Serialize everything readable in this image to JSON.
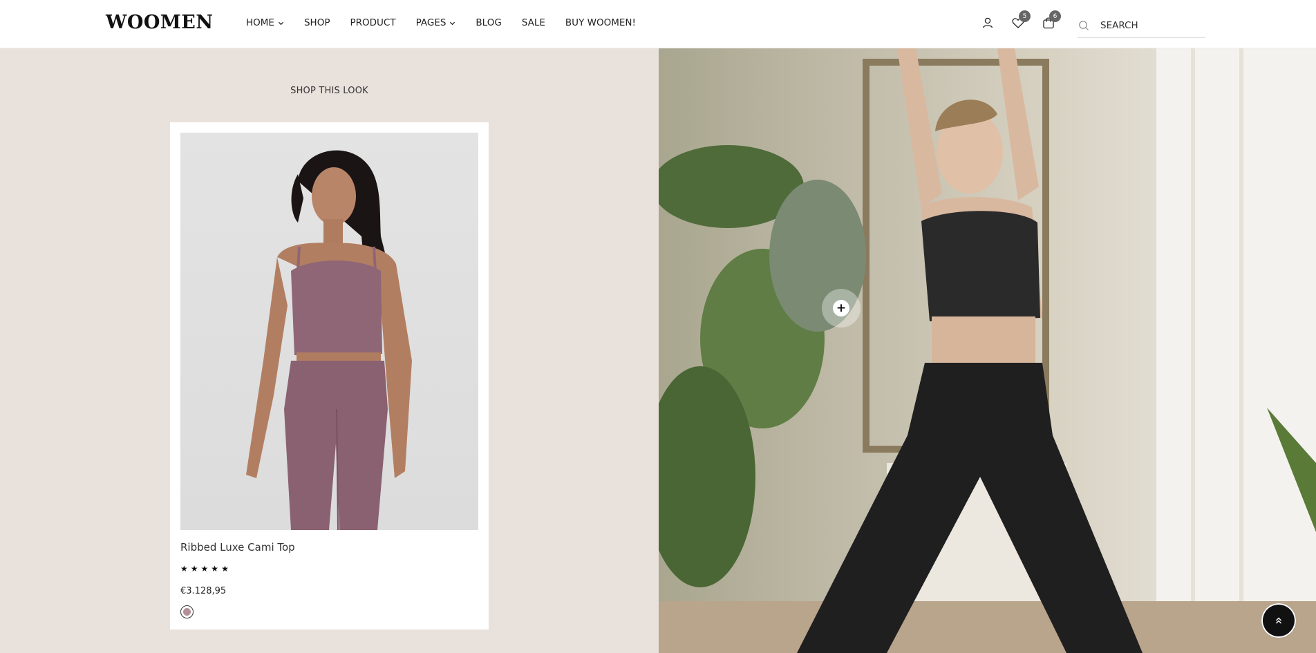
{
  "brand": {
    "logo_text": "WOOMEN"
  },
  "nav": {
    "items": [
      {
        "label": "HOME",
        "has_dropdown": true
      },
      {
        "label": "SHOP",
        "has_dropdown": false
      },
      {
        "label": "PRODUCT",
        "has_dropdown": false
      },
      {
        "label": "PAGES",
        "has_dropdown": true
      },
      {
        "label": "BLOG",
        "has_dropdown": false
      },
      {
        "label": "SALE",
        "has_dropdown": false
      },
      {
        "label": "BUY WOOMEN!",
        "has_dropdown": false
      }
    ]
  },
  "header_icons": {
    "account": {
      "icon": "user-icon"
    },
    "wishlist": {
      "icon": "heart-icon",
      "count": "5"
    },
    "cart": {
      "icon": "bag-icon",
      "count": "6"
    }
  },
  "search": {
    "placeholder": "SEARCH",
    "icon": "search-icon"
  },
  "look": {
    "heading": "SHOP THIS LOOK",
    "product": {
      "name": "Ribbed Luxe Cami Top",
      "rating": 5,
      "price": "€3.128,95",
      "swatch_color": "#b38f96"
    }
  },
  "colors": {
    "left_panel_bg": "#e9e1dc",
    "product_color": "#8f6676",
    "hotspot": "#ffffff"
  }
}
